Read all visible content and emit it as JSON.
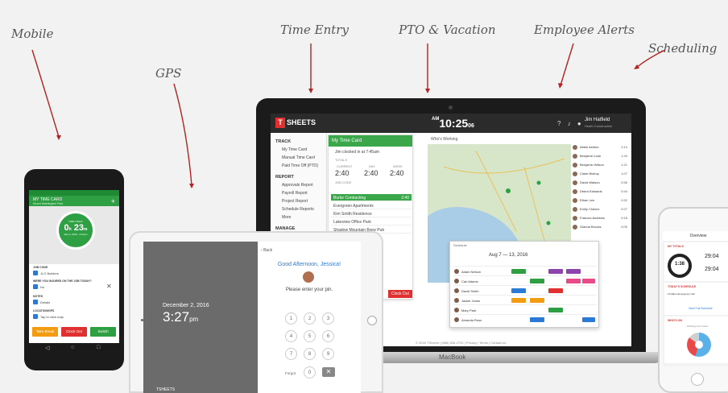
{
  "annotations": {
    "mobile": "Mobile",
    "gps": "GPS",
    "time_entry": "Time Entry",
    "pto": "PTO & Vacation",
    "alerts": "Employee Alerts",
    "scheduling": "Scheduling"
  },
  "laptop": {
    "brand": "MacBook",
    "app": {
      "logo_letter": "T",
      "logo_text": "SHEETS",
      "clock": {
        "prefix": "AM",
        "time": "10:25",
        "seconds": "06"
      },
      "user_name": "Jim Hatfield",
      "user_company": "Heath Construction",
      "nav": {
        "track": "TRACK",
        "track_items": [
          "My Time Card",
          "Manual Time Card",
          "Paid Time Off (PTO)"
        ],
        "report": "REPORT",
        "report_items": [
          "Approvals Report",
          "Payroll Report",
          "Project Report",
          "Schedule Reports",
          "More"
        ],
        "manage": "MANAGE"
      },
      "time_card": {
        "title": "My Time Card",
        "clocked_in": "Jim clocked in at 7:45am",
        "totals_label": "TOTALS",
        "current_label": "CURRENT",
        "day_label": "DAY",
        "week_label": "WEEK",
        "current": "2:40",
        "day": "2:40",
        "week": "2:40",
        "job_code_label": "JOB CODE",
        "jobs": [
          "Burke Contracting",
          "Evergreen Apartments",
          "Kim Smith Residence",
          "Lakeview Office Park",
          "Shadow Mountain Brew Pub"
        ],
        "selected_job_time": "2:40",
        "clock_out": "Clock Out"
      },
      "map": {
        "title": "Who's Working"
      },
      "employees": [
        {
          "name": "Abbie Ashton",
          "time": "2:14"
        },
        {
          "name": "Benjamin Lusk",
          "time": "1:43"
        },
        {
          "name": "Benjamin Wilson",
          "time": "1:21"
        },
        {
          "name": "Claire Bishop",
          "time": "1:07"
        },
        {
          "name": "David Watson",
          "time": "0:56"
        },
        {
          "name": "Debra Edwards",
          "time": "0:44"
        },
        {
          "name": "Ethan Lee",
          "time": "0:32"
        },
        {
          "name": "Emily Chavez",
          "time": "0:27"
        },
        {
          "name": "Frances Andrews",
          "time": "0:18"
        },
        {
          "name": "Gianna Brooks",
          "time": "0:09"
        }
      ],
      "schedule": {
        "title": "Schedule",
        "range": "Aug 7 — 13, 2016",
        "rows": [
          "Adam Nelson",
          "Carl Adams",
          "David Smith",
          "Jackie Jones",
          "Mary Park",
          "Amanda Ross"
        ]
      },
      "footer": "© 2016 TSheets  |  (888) 836-2720  |  Privacy  |  Terms  |  Contact us"
    }
  },
  "android": {
    "header_title": "MY TIME CARD",
    "header_sub": "Mount Washington Park",
    "hero": {
      "label": "TIME TODAY",
      "hours": "0",
      "hours_unit": "h",
      "minutes": "23",
      "minutes_unit": "m",
      "date": "Dec 2, 2016 · 3:27pm"
    },
    "job_code_label": "JOB CODE",
    "job_code_value": "JLG Builders",
    "question_label": "WERE YOU INJURED ON THE JOB TODAY?",
    "question_value": "No",
    "notes_label": "NOTES",
    "notes_value": "Details",
    "location_label": "LOCATION/GPS",
    "location_value": "Tap to view map",
    "buttons": [
      "Take Break",
      "Clock Out",
      "Switch"
    ]
  },
  "ipad": {
    "date": "December 2, 2016",
    "time": "3:27",
    "ampm": "pm",
    "logo": "TSHEETS",
    "back": "Back",
    "greeting": "Good Afternoon, Jessica!",
    "prompt": "Please enter your pin.",
    "keys": [
      "1",
      "2",
      "3",
      "4",
      "5",
      "6",
      "7",
      "8",
      "9",
      "0"
    ],
    "forgot": "Forgot",
    "delete": "✕"
  },
  "iphone": {
    "title": "Overview",
    "my_totals": "MY TOTALS",
    "ring_value": "1:38",
    "stat_one": "29:04",
    "stat_two": "29:04",
    "schedule_title": "TODAY'S SCHEDULE",
    "schedule_entry": "12:00pm Emergency Call",
    "schedule_link": "View Full Schedule",
    "chart_title": "WHO'S ON",
    "chart_sub": "Working Job Codes"
  },
  "colors": {
    "brand_red": "#e03030",
    "brand_green": "#2ea043",
    "link_blue": "#2b7bd6"
  }
}
